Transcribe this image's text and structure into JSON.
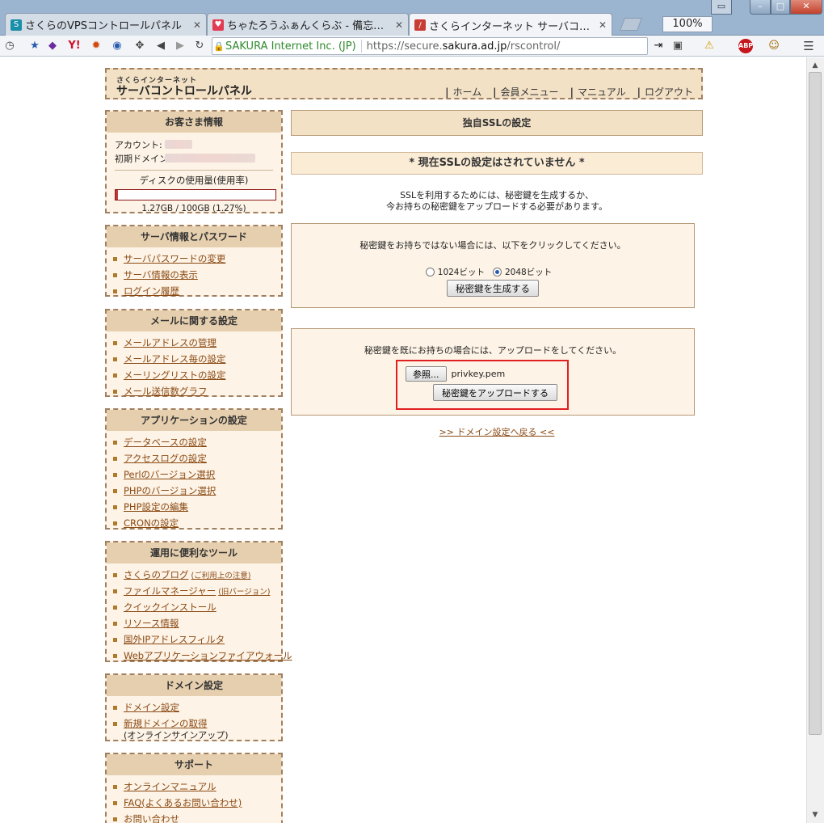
{
  "browser": {
    "tabs": [
      {
        "title": "さくらのVPSコントロールパネル",
        "favicon_color": "#1a8fa8"
      },
      {
        "title": "ちゃたろうふぁんくらぶ - 備忘…",
        "favicon_color": "#e23a52"
      },
      {
        "title": "さくらインターネット サーバコン…",
        "favicon_color": "#c83d35"
      }
    ],
    "zoom": "100%",
    "url": {
      "identity": "SAKURA Internet Inc. (JP)",
      "prefix": "https://secure.",
      "domain": "sakura.ad.jp",
      "path": "/rscontrol/"
    }
  },
  "header": {
    "logo_small": "さくらインターネット",
    "logo_main": "サーバコントロールパネル",
    "nav": [
      "ホーム",
      "会員メニュー",
      "マニュアル",
      "ログアウト"
    ]
  },
  "customer": {
    "title": "お客さま情報",
    "account_label": "アカウント:",
    "domain_label": "初期ドメイン:",
    "disk_title": "ディスクの使用量(使用率)",
    "disk_usage_fraction": 0.0127,
    "disk_text": "1.27GB / 100GB (1.27%)"
  },
  "sidebar": {
    "server": {
      "title": "サーバ情報とパスワード",
      "items": [
        "サーバパスワードの変更",
        "サーバ情報の表示",
        "ログイン履歴"
      ]
    },
    "mail": {
      "title": "メールに関する設定",
      "items": [
        "メールアドレスの管理",
        "メールアドレス毎の設定",
        "メーリングリストの設定",
        "メール送信数グラフ"
      ]
    },
    "app": {
      "title": "アプリケーションの設定",
      "items": [
        "データベースの設定",
        "アクセスログの設定",
        "Perlのバージョン選択",
        "PHPのバージョン選択",
        "PHP設定の編集",
        "CRONの設定"
      ]
    },
    "tools": {
      "title": "運用に便利なツール",
      "items": [
        {
          "label": "さくらのブログ",
          "note": "(ご利用上の注意)"
        },
        {
          "label": "ファイルマネージャー",
          "note": "(旧バージョン)"
        },
        {
          "label": "クイックインストール",
          "note": ""
        },
        {
          "label": "リソース情報",
          "note": ""
        },
        {
          "label": "国外IPアドレスフィルタ",
          "note": ""
        },
        {
          "label": "Webアプリケーションファイアウォール",
          "note": ""
        }
      ]
    },
    "domain": {
      "title": "ドメイン設定",
      "items": [
        "ドメイン設定",
        "新規ドメインの取得"
      ],
      "signup_note": "(オンラインサインアップ)"
    },
    "support": {
      "title": "サポート",
      "items": [
        "オンラインマニュアル",
        "FAQ(よくあるお問い合わせ)",
        "お問い合わせ"
      ]
    }
  },
  "main": {
    "title": "独自SSLの設定",
    "status": "* 現在SSLの設定はされていません *",
    "intro_line1": "SSLを利用するためには、秘密鍵を生成するか、",
    "intro_line2": "今お持ちの秘密鍵をアップロードする必要があります。",
    "generate": {
      "text": "秘密鍵をお持ちではない場合には、以下をクリックしてください。",
      "option1": "1024ビット",
      "option2": "2048ビット",
      "selected": "2048ビット",
      "button": "秘密鍵を生成する"
    },
    "upload": {
      "text": "秘密鍵を既にお持ちの場合には、アップロードをしてください。",
      "browse_button": "参照...",
      "filename": "privkey.pem",
      "button": "秘密鍵をアップロードする"
    },
    "back_link": ">> ドメイン設定へ戻る <<"
  }
}
